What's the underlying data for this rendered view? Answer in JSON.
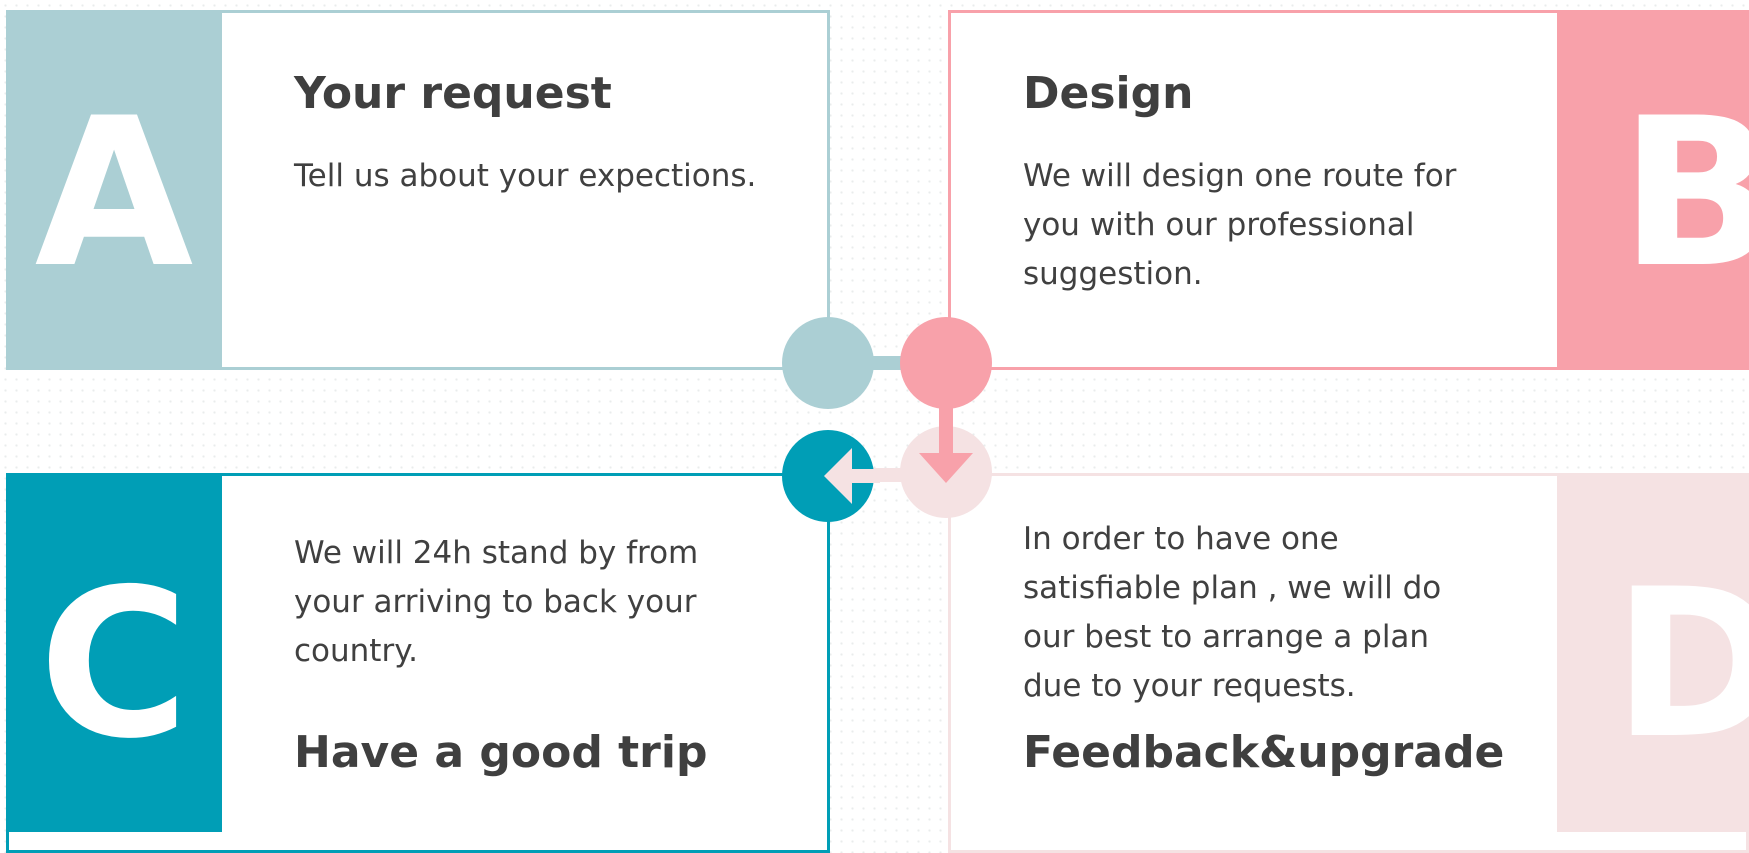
{
  "colors": {
    "a": "#abcfd4",
    "b": "#f8a1aa",
    "c": "#009eb6",
    "d": "#f5e2e3",
    "text": "#3f3f3f"
  },
  "steps": {
    "a": {
      "letter": "A",
      "title": "Your request",
      "description": "Tell us about your expections."
    },
    "b": {
      "letter": "B",
      "title": "Design",
      "description": "We will design one route for you with our professional suggestion."
    },
    "c": {
      "letter": "C",
      "title": "Have a good trip",
      "description": "We will 24h stand by from your arriving to back your country."
    },
    "d": {
      "letter": "D",
      "title": "Feedback&upgrade",
      "description": "In order to have one satisfiable plan , we will do our best to arrange a plan due to your requests."
    }
  }
}
